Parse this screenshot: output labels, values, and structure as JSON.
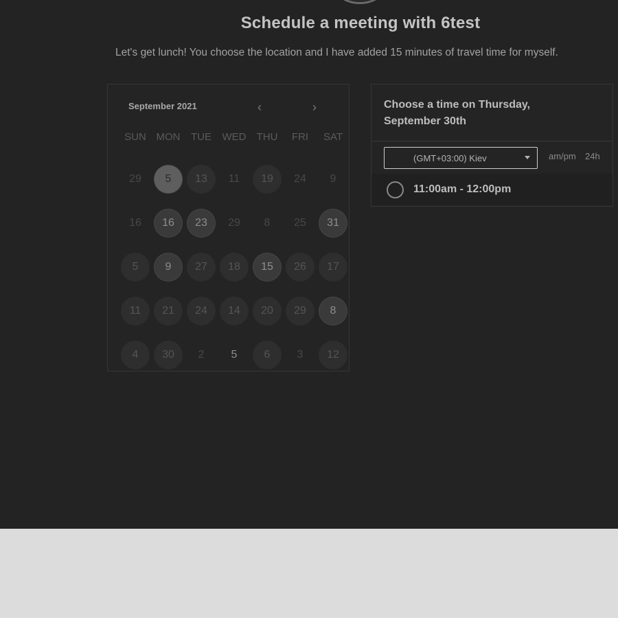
{
  "header": {
    "title": "Schedule a meeting with 6test",
    "subtitle": "Let's get lunch! You choose the location and I have added 15 minutes of travel time for myself."
  },
  "calendar": {
    "month_label": "September 2021",
    "prev_icon": "‹",
    "next_icon": "›",
    "weekdays": [
      "SUN",
      "MON",
      "TUE",
      "WED",
      "THU",
      "FRI",
      "SAT"
    ],
    "days": [
      {
        "label": "29",
        "state": "plain"
      },
      {
        "label": "5",
        "state": "selected"
      },
      {
        "label": "13",
        "state": "available"
      },
      {
        "label": "11",
        "state": "plain"
      },
      {
        "label": "19",
        "state": "available"
      },
      {
        "label": "24",
        "state": "plain"
      },
      {
        "label": "9",
        "state": "plain"
      },
      {
        "label": "16",
        "state": "plain"
      },
      {
        "label": "16",
        "state": "highlighted"
      },
      {
        "label": "23",
        "state": "highlighted"
      },
      {
        "label": "29",
        "state": "plain"
      },
      {
        "label": "8",
        "state": "plain"
      },
      {
        "label": "25",
        "state": "plain"
      },
      {
        "label": "31",
        "state": "highlighted"
      },
      {
        "label": "5",
        "state": "available"
      },
      {
        "label": "9",
        "state": "highlighted"
      },
      {
        "label": "27",
        "state": "available"
      },
      {
        "label": "18",
        "state": "available"
      },
      {
        "label": "15",
        "state": "highlighted"
      },
      {
        "label": "26",
        "state": "available"
      },
      {
        "label": "17",
        "state": "available"
      },
      {
        "label": "11",
        "state": "available"
      },
      {
        "label": "21",
        "state": "available"
      },
      {
        "label": "24",
        "state": "available"
      },
      {
        "label": "14",
        "state": "available"
      },
      {
        "label": "20",
        "state": "available"
      },
      {
        "label": "29",
        "state": "available"
      },
      {
        "label": "8",
        "state": "highlighted"
      },
      {
        "label": "4",
        "state": "available"
      },
      {
        "label": "30",
        "state": "available"
      },
      {
        "label": "2",
        "state": "plain"
      },
      {
        "label": "5",
        "state": "bright"
      },
      {
        "label": "6",
        "state": "available"
      },
      {
        "label": "3",
        "state": "plain"
      },
      {
        "label": "12",
        "state": "available"
      }
    ]
  },
  "panel": {
    "title": "Choose a time on Thursday, September 30th",
    "timezone": "(GMT+03:00) Kiev",
    "format_ampm": "am/pm",
    "format_24h": "24h",
    "slots": [
      {
        "label": "11:00am - 12:00pm"
      }
    ]
  }
}
